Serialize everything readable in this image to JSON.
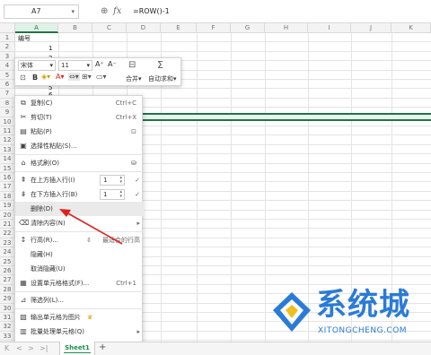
{
  "formula_bar": {
    "name_box": "A7",
    "zoom_icon": "zoom-in-icon",
    "fx": "fx",
    "formula": "=ROW()-1"
  },
  "columns": [
    "A",
    "B",
    "C",
    "D",
    "E",
    "F",
    "G",
    "H",
    "I",
    "J",
    "K"
  ],
  "rows": [
    "1",
    "2",
    "3",
    "4",
    "5",
    "6",
    "7",
    "8",
    "9",
    "10",
    "11",
    "12",
    "13",
    "14",
    "15",
    "16",
    "17",
    "18",
    "19",
    "20",
    "21",
    "22",
    "23",
    "24",
    "25",
    "26",
    "27",
    "28",
    "29",
    "30",
    "31",
    "32",
    "33",
    "34"
  ],
  "cells": {
    "a1": "编号",
    "a2": "1",
    "a3": "2",
    "a4": "3",
    "a6": "5",
    "a8": "6"
  },
  "mini_toolbar": {
    "font_name": "宋体",
    "font_size": "11",
    "grow_font": "A⁺",
    "shrink_font": "A⁻",
    "merge_label": "合并",
    "autosum_label": "自动求和"
  },
  "context_menu": {
    "copy": {
      "label": "复制(C)",
      "shortcut": "Ctrl+C"
    },
    "cut": {
      "label": "剪切(T)",
      "shortcut": "Ctrl+X"
    },
    "paste": {
      "label": "粘贴(P)"
    },
    "paste_special": {
      "label": "选择性粘贴(S)..."
    },
    "format_painter": {
      "label": "格式刷(O)"
    },
    "insert_above": {
      "label": "在上方插入行(I)",
      "value": "1"
    },
    "insert_below": {
      "label": "在下方插入行(B)",
      "value": "1"
    },
    "delete": {
      "label": "删除(D)"
    },
    "clear": {
      "label": "清除内容(N)"
    },
    "row_height": {
      "label": "行高(R)...",
      "best_fit": "最适合的行高"
    },
    "hide": {
      "label": "隐藏(H)"
    },
    "unhide": {
      "label": "取消隐藏(U)"
    },
    "format_cells": {
      "label": "设置单元格格式(F)...",
      "shortcut": "Ctrl+1"
    },
    "filter": {
      "label": "筛选列(L)..."
    },
    "export_image": {
      "label": "输出单元格为图片"
    },
    "batch": {
      "label": "批量处理单元格(Q)"
    }
  },
  "sheet_tabs": {
    "active": "Sheet1",
    "add": "+"
  },
  "watermark": {
    "text": "系统城",
    "url": "XITONGCHENG.COM"
  },
  "colors": {
    "accent": "#217346",
    "sheet_tab": "#1a8f4b",
    "arrow": "#e0201b",
    "watermark": "#2b7bd6"
  }
}
